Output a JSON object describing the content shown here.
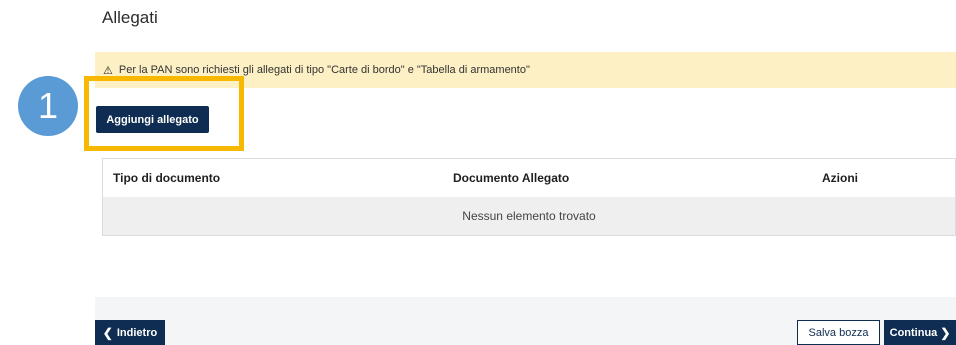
{
  "section": {
    "title": "Allegati"
  },
  "alert": {
    "icon": "warning-icon",
    "text": "Per la PAN sono richiesti gli allegati di tipo \"Carte di bordo\" e \"Tabella di armamento\""
  },
  "actions": {
    "add_label": "Aggiungi allegato"
  },
  "annotation": {
    "step": "1",
    "highlight_color": "#f6b800",
    "circle_color": "#5b9bd5"
  },
  "table": {
    "headers": [
      "Tipo di documento",
      "Documento Allegato",
      "Azioni"
    ],
    "empty_message": "Nessun elemento trovato"
  },
  "footer": {
    "back_label": "Indietro",
    "save_label": "Salva bozza",
    "continue_label": "Continua"
  },
  "colors": {
    "primary": "#0f2d52",
    "alert_bg": "#fdf0c4"
  }
}
